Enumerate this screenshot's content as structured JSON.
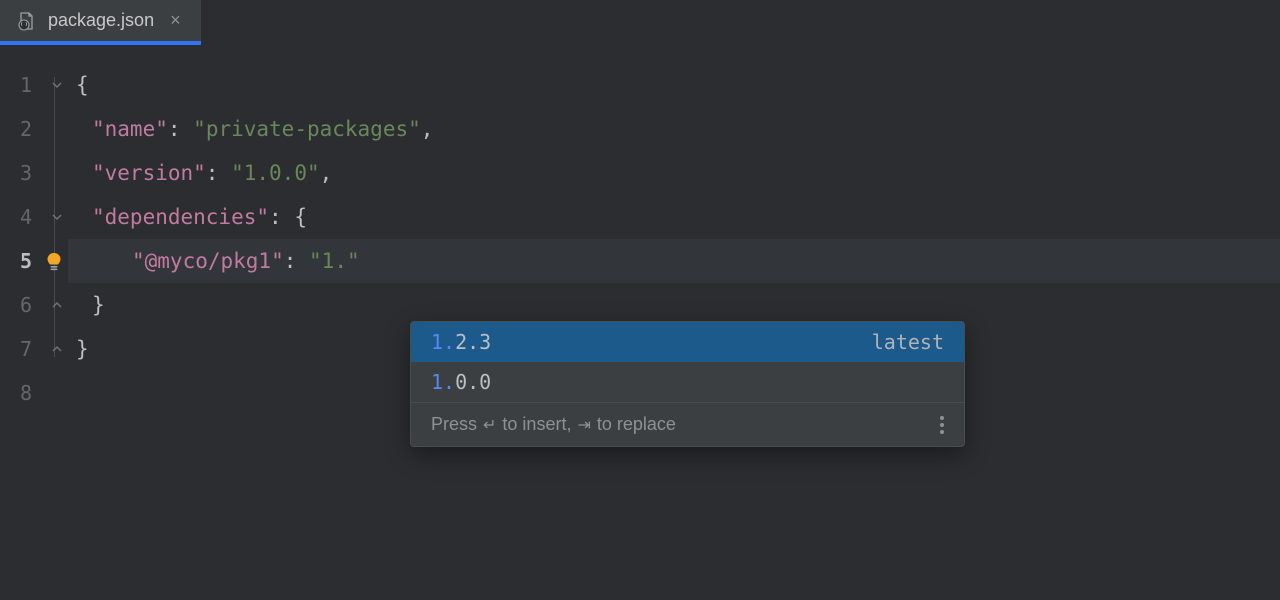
{
  "tab": {
    "filename": "package.json"
  },
  "lines": {
    "l1": "1",
    "l2": "2",
    "l3": "3",
    "l4": "4",
    "l5": "5",
    "l6": "6",
    "l7": "7",
    "l8": "8"
  },
  "code": {
    "openBrace": "{",
    "nameKey": "\"name\"",
    "nameValue": "\"private-packages\"",
    "versionKey": "\"version\"",
    "versionValue": "\"1.0.0\"",
    "depsKey": "\"dependencies\"",
    "depsOpenBrace": "{",
    "pkgKey": "\"@myco/pkg1\"",
    "pkgValue": "\"1.\"",
    "closeBraceInner": "}",
    "closeBrace": "}",
    "colon": ":",
    "comma": ","
  },
  "autocomplete": {
    "items": [
      {
        "prefix": "1.",
        "rest": "2.3",
        "tag": "latest"
      },
      {
        "prefix": "1.",
        "rest": "0.0",
        "tag": ""
      }
    ],
    "footer": {
      "press": "Press ",
      "toInsert": " to insert, ",
      "toReplace": " to replace",
      "enterGlyph": "↵",
      "tabGlyph": "⇥"
    }
  }
}
